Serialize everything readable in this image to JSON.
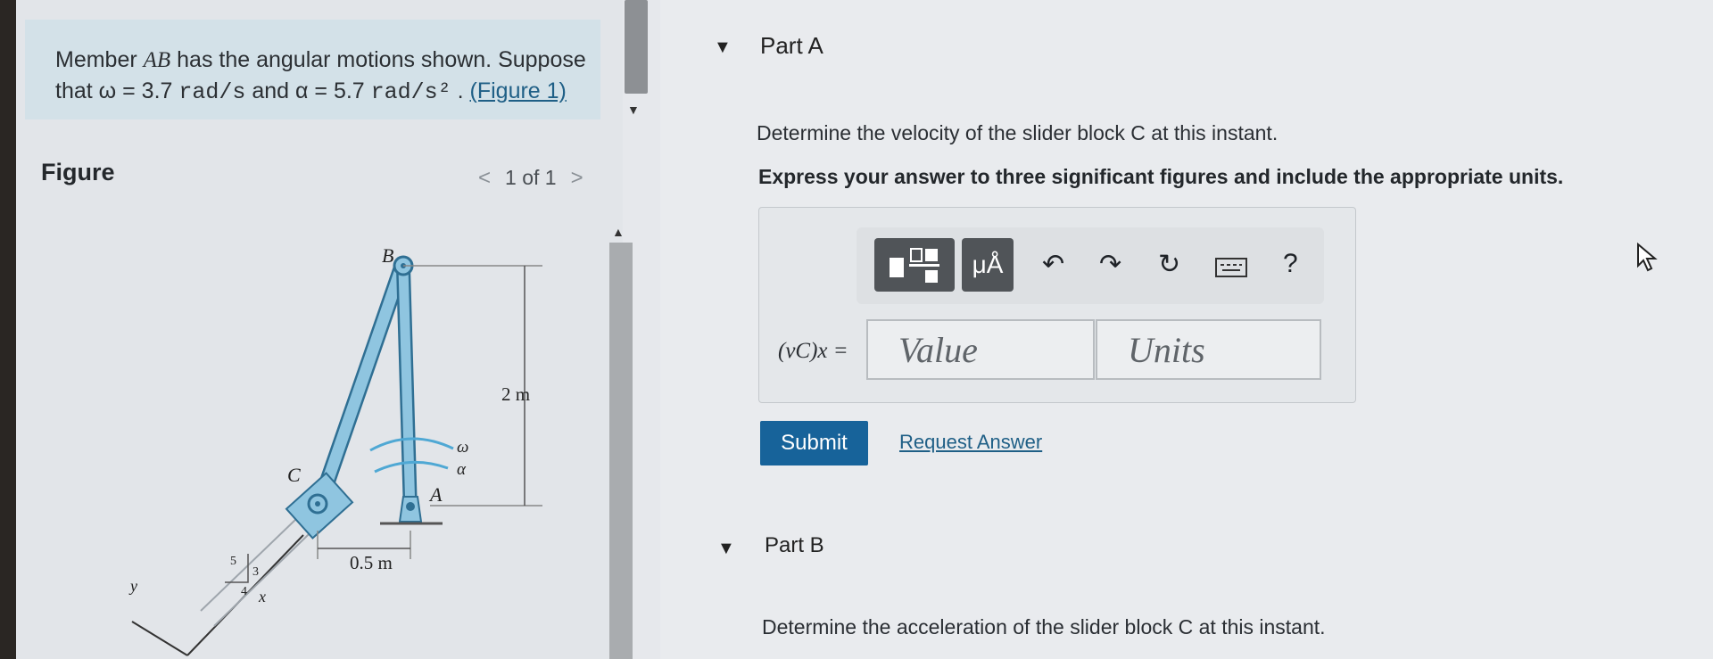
{
  "problem": {
    "line1_pre": "Member ",
    "line1_var": "AB",
    "line1_post": " has the angular motions shown. Suppose",
    "line2_pre": "that ",
    "omega_expr": "ω = 3.7",
    "omega_unit": "rad/s",
    "mid": " and ",
    "alpha_expr": "α = 5.7",
    "alpha_unit": "rad/s²",
    "dot": " . ",
    "figure_link": "(Figure 1)"
  },
  "figure": {
    "heading": "Figure",
    "pager": "1 of 1",
    "prev": "<",
    "next": ">",
    "labels": {
      "b": "B",
      "c": "C",
      "a": "A",
      "height": "2 m",
      "width": "0.5 m",
      "omega": "ω",
      "alpha": "α",
      "tri5": "5",
      "tri3": "3",
      "tri4": "4",
      "x": "x",
      "y": "y"
    }
  },
  "part_a": {
    "title": "Part A",
    "question": "Determine the velocity of the slider block C at this instant.",
    "instruction": "Express your answer to three significant figures and include the appropriate units.",
    "equation_label": "(vC)x =",
    "value_placeholder": "Value",
    "units_placeholder": "Units",
    "submit": "Submit",
    "request": "Request Answer",
    "toolbar": {
      "templates_icon": "fraction-template-icon",
      "units_button": "μÅ",
      "undo_icon": "undo-icon",
      "redo_icon": "redo-icon",
      "reset_icon": "reset-icon",
      "keyboard_icon": "keyboard-icon",
      "help": "?"
    }
  },
  "part_b": {
    "title": "Part B",
    "question": "Determine the acceleration of the slider block C at this instant."
  },
  "colors": {
    "accent": "#17639a",
    "member": "#8fc5e0",
    "problem_bg": "#d3e1e8"
  }
}
